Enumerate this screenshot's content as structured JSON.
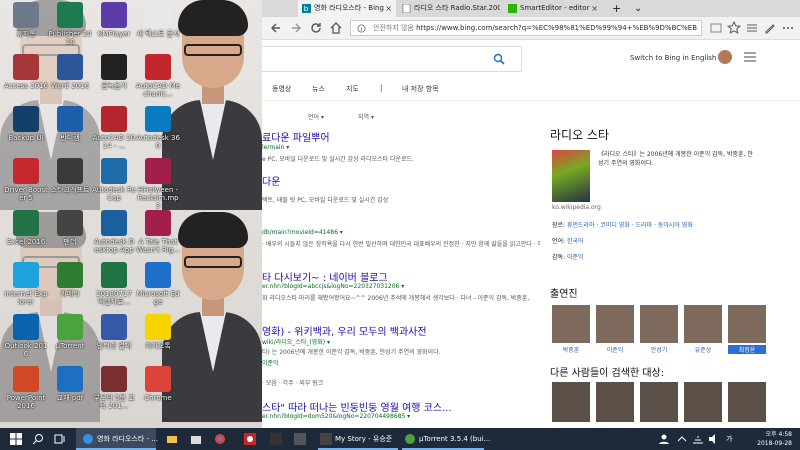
{
  "desktop": {
    "icons": [
      {
        "label": "휴지통",
        "color": "#6c7a89"
      },
      {
        "label": "Publisher 2016",
        "color": "#1e7a4f"
      },
      {
        "label": "KMPlayer",
        "color": "#5a3ba8"
      },
      {
        "label": "새 텍스트 문서",
        "color": "#e8e8e8"
      },
      {
        "label": "Access 2016",
        "color": "#a4373a"
      },
      {
        "label": "Word 2016",
        "color": "#2b579a"
      },
      {
        "label": "곰녹음기",
        "color": "#222222"
      },
      {
        "label": "AutoCAD Mechanic...",
        "color": "#c1272d"
      },
      {
        "label": "Backup UI",
        "color": "#153f6b"
      },
      {
        "label": "반디캠",
        "color": "#1d5fa8"
      },
      {
        "label": "AutoCAD 2014 - ...",
        "color": "#b3262d"
      },
      {
        "label": "Autodesk 360",
        "color": "#0b7bc1"
      },
      {
        "label": "Driver Booster 5",
        "color": "#c6292d"
      },
      {
        "label": "스타크래프트",
        "color": "#3a3a3a"
      },
      {
        "label": "Autodesk ReCap",
        "color": "#1f6da8"
      },
      {
        "label": "HHolween - Reclaim.mp3",
        "color": "#a31f4b"
      },
      {
        "label": "Excel 2016",
        "color": "#217346"
      },
      {
        "label": "팬더",
        "color": "#444444"
      },
      {
        "label": "Autodesk Desktop App",
        "color": "#1b5f9e"
      },
      {
        "label": "A Tale That Wasn't Rig...",
        "color": "#a31f4b"
      },
      {
        "label": "Internet Explorer",
        "color": "#1ea2e0"
      },
      {
        "label": "카메라",
        "color": "#2e7d32"
      },
      {
        "label": "20180717 엑셀자료...",
        "color": "#217346"
      },
      {
        "label": "Microsoft Edge",
        "color": "#1e6fcc"
      },
      {
        "label": "Outlook 2016",
        "color": "#0a64ad"
      },
      {
        "label": "µTorrent",
        "color": "#4aa33e"
      },
      {
        "label": "인터넷 결제",
        "color": "#3558a8"
      },
      {
        "label": "카카오톡",
        "color": "#f7d400"
      },
      {
        "label": "PowerPoint 2016",
        "color": "#d24726"
      },
      {
        "label": "교재 pdf",
        "color": "#1d6fc2"
      },
      {
        "label": "부모의 5분 교육 201...",
        "color": "#7a2e2e"
      },
      {
        "label": "Chrome",
        "color": "#db4437"
      }
    ]
  },
  "browser": {
    "tabs": [
      {
        "label": "영화 라디오스타 - Bing",
        "active": true
      },
      {
        "label": "라디오 스타 Radio.Star.200",
        "active": false
      },
      {
        "label": "SmartEditor - editor",
        "active": false
      }
    ],
    "new_tab_glyph": "+",
    "dropdown_glyph": "⌄",
    "address": {
      "security": "안전하지 않음",
      "url": "https://www.bing.com/search?q=%EC%98%81%ED%99%94+%EB%9D%BC%EB"
    }
  },
  "bing": {
    "switch_label": "Switch to Bing in English",
    "nav": [
      "동영상",
      "뉴스",
      "지도",
      "|",
      "내 저장 항목"
    ],
    "filters": [
      "언어 ▾",
      "지역 ▾"
    ]
  },
  "results": [
    {
      "title": "료다운 파일뿌어",
      "url": "le/main ▾",
      "desc": "e PC, 모바일 다운로드 및 실시간 감상 라디오스타 다운로드."
    },
    {
      "title": "다운",
      "url": "",
      "desc": "택트, 태블 릿 PC, 모바일 다운로드 및 실시간 감상"
    },
    {
      "title": "",
      "url": "db/main?movieId=41486 ▾",
      "desc": "· 배우의 시들지 않은 창작욕을 다시 한번 빌산하며 대한민국 대표배우의 진정한 · 지만 함께 삶을을 읽고안다 · 해피 8n"
    },
    {
      "title": "타 다시보기~ : 네이버 블로그",
      "url": "er.nhn?blogId=abccjs&logNo=220327031206 ▾",
      "desc": "화 라디오스타 마리를 재봤어봤어요~^^ 2006년 추석에 개봉해서 생각보다 · 다녀 - 이준익 감독, 박중훈,"
    },
    {
      "title": "영화) - 위키백과, 우리 모두의 백과사전",
      "url": "wiki/라디오_스타_(영화) ▾",
      "desc": "타) 는 2006년에 개봉한 이준익 감독, 박중훈, 안성기 주연의 영화이다."
    },
    {
      "title": "",
      "url": "이준익",
      "desc": "· 모음 · 각주 · 외부 링크"
    },
    {
      "title": "스타\" 따라 떠나는 빈둥빈둥 영월 여행 코스...",
      "url": "er.nhn?blogId=dom520&logNo=220704498685 ▾",
      "desc": ""
    }
  ],
  "panel": {
    "title": "라디오 스타",
    "desc": "《라디오 스타》는 2006년에 개봉한 이준익 감독, 박중훈, 안성기 주연의 영화이다.",
    "source": "ko.wikipedia.org",
    "facts": [
      {
        "k": "장르: ",
        "v": "휴먼드라마 · 코미디 영화 · 드라마 · 동아시아 영화"
      },
      {
        "k": "언어: ",
        "v": "한국어"
      },
      {
        "k": "감독: ",
        "v": "이준익"
      }
    ],
    "cast_title": "출연진",
    "cast": [
      "박중훈",
      "이준익",
      "안성기",
      "유준상",
      "최정윤"
    ],
    "also_title": "다른 사람들이 검색한 대상:"
  },
  "taskbar": {
    "items": [
      {
        "label": "영화 라디오스타 - ..."
      },
      {
        "label": "My Story - 유승준"
      },
      {
        "label": "µTorrent 3.5.4  (bui..."
      }
    ],
    "ime": "가",
    "time": "오후 4:58",
    "date": "2018-09-28"
  }
}
